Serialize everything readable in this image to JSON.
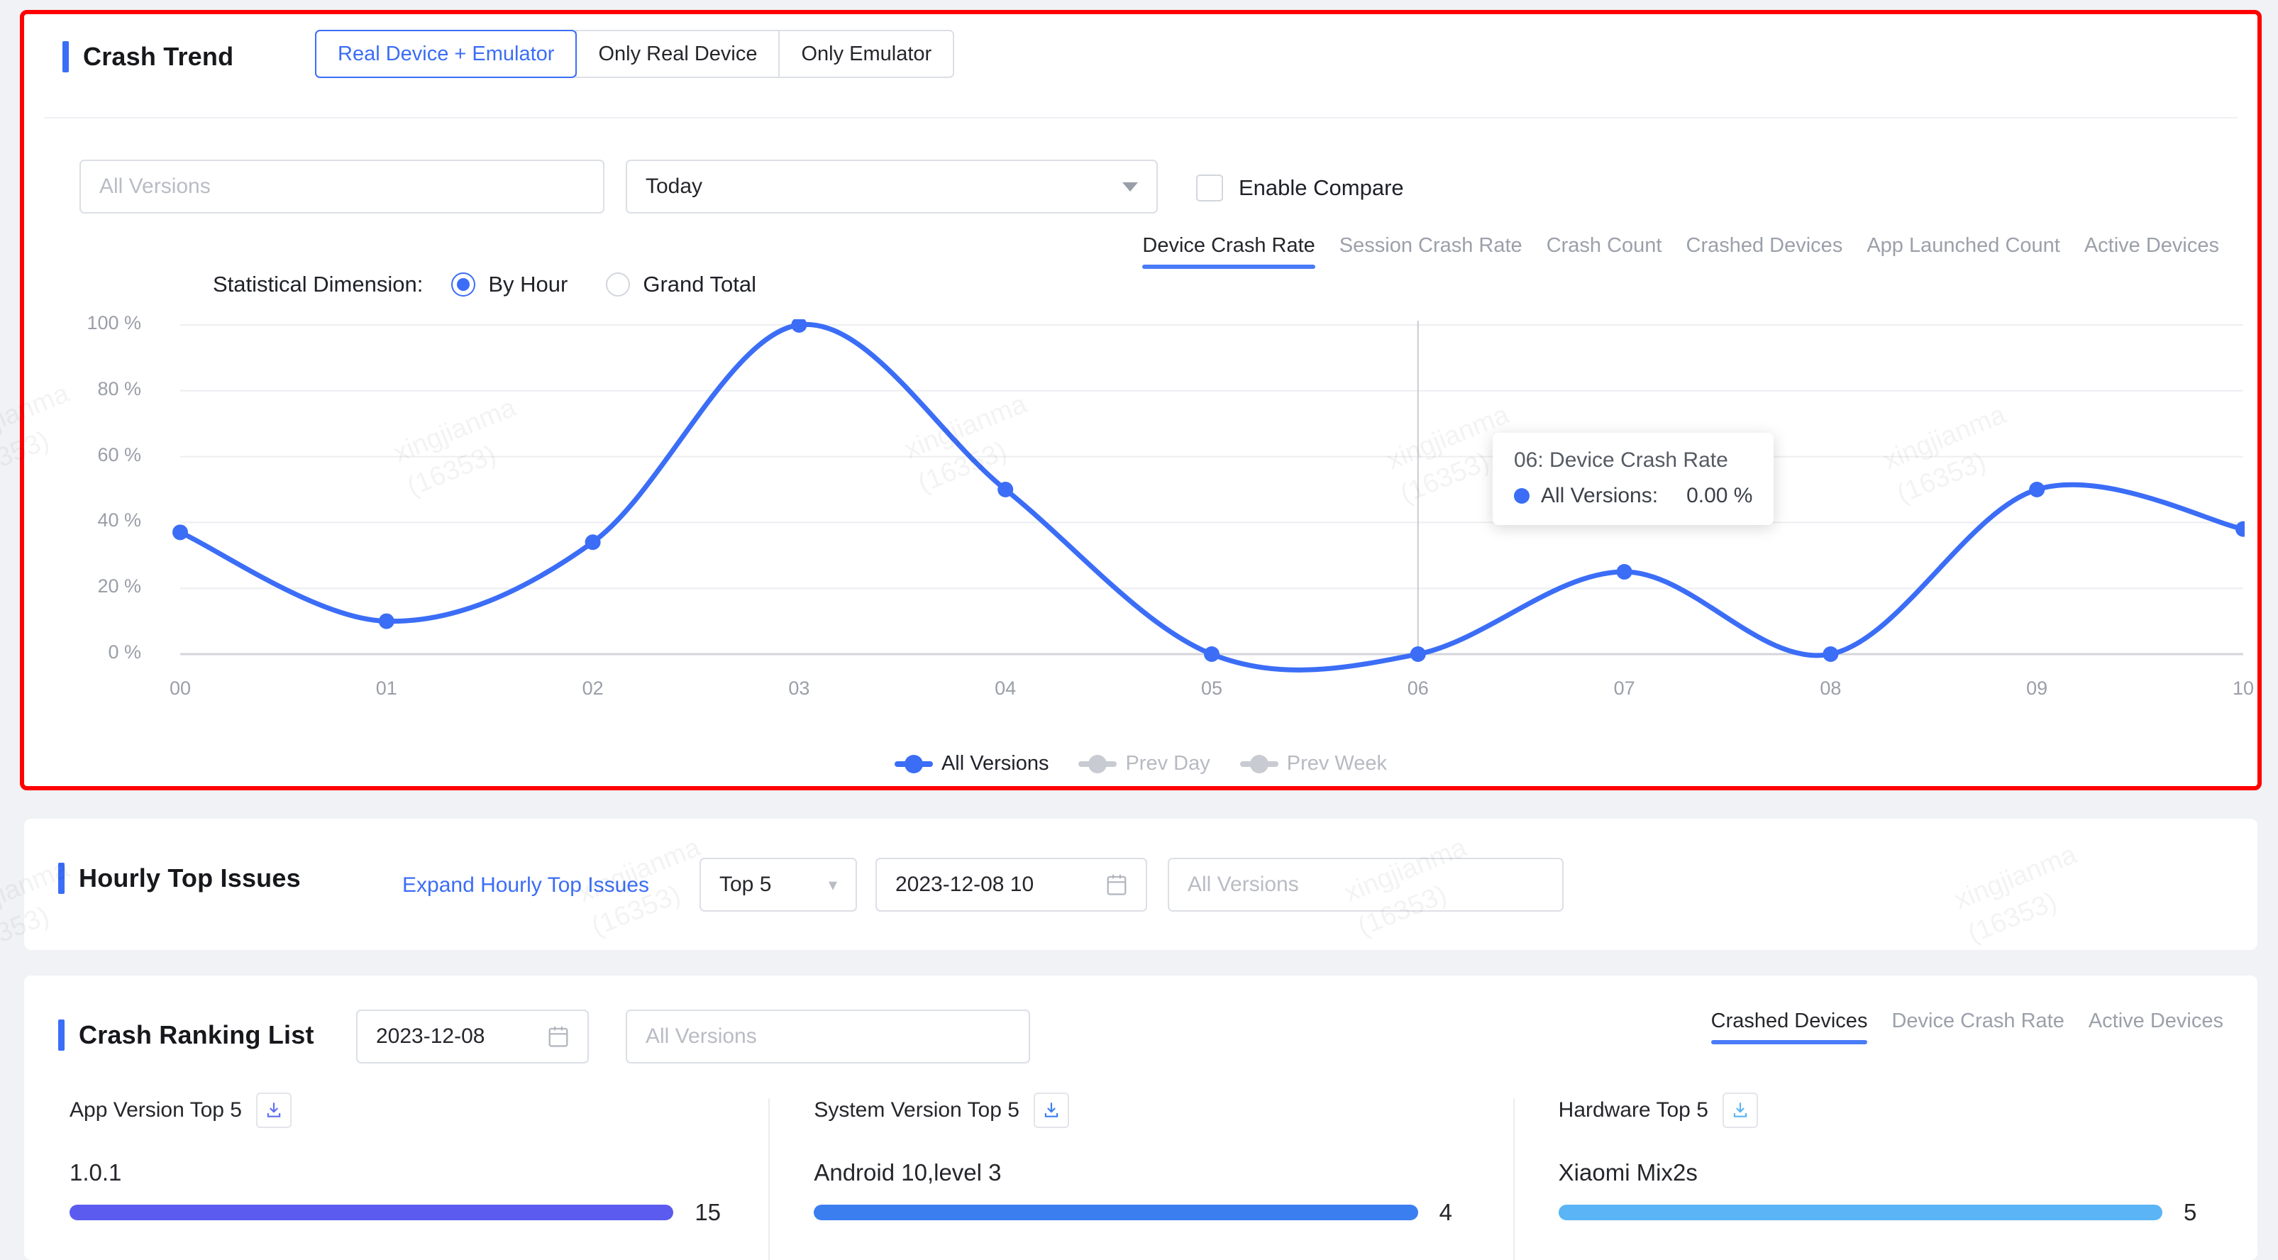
{
  "watermark": {
    "line1": "xingjianma",
    "line2": "(16353)"
  },
  "crash_trend": {
    "title": "Crash Trend",
    "device_filter": {
      "options": [
        "Real Device + Emulator",
        "Only Real Device",
        "Only Emulator"
      ],
      "selected": "Real Device + Emulator"
    },
    "version_input": {
      "placeholder": "All Versions",
      "value": ""
    },
    "date_select": {
      "value": "Today",
      "icon": "chevron-down-icon"
    },
    "enable_compare": {
      "label": "Enable Compare",
      "checked": false
    },
    "metric_tabs": {
      "items": [
        "Device Crash Rate",
        "Session Crash Rate",
        "Crash Count",
        "Crashed Devices",
        "App Launched Count",
        "Active Devices"
      ],
      "active": "Device Crash Rate"
    },
    "statistical_dimension": {
      "label": "Statistical Dimension:",
      "options": [
        "By Hour",
        "Grand Total"
      ],
      "selected": "By Hour"
    },
    "tooltip": {
      "title": "06: Device Crash Rate",
      "series_name": "All Versions:",
      "value": "0.00 %"
    },
    "legend": [
      {
        "label": "All Versions",
        "enabled": true,
        "color": "#3b6df6"
      },
      {
        "label": "Prev Day",
        "enabled": false,
        "color": "#c8cbd1"
      },
      {
        "label": "Prev Week",
        "enabled": false,
        "color": "#c8cbd1"
      }
    ]
  },
  "chart_data": {
    "type": "line",
    "title": "Crash Trend",
    "xlabel": "",
    "ylabel": "",
    "ylim": [
      0,
      100
    ],
    "yticks": [
      "0 %",
      "20 %",
      "40 %",
      "60 %",
      "80 %",
      "100 %"
    ],
    "ytick_values": [
      0,
      20,
      40,
      60,
      80,
      100
    ],
    "x": [
      "00",
      "01",
      "02",
      "03",
      "04",
      "05",
      "06",
      "07",
      "08",
      "09",
      "10"
    ],
    "grid": true,
    "legend_position": "bottom",
    "series": [
      {
        "name": "All Versions",
        "color": "#3b6df6",
        "values": [
          37,
          10,
          34,
          100,
          50,
          0,
          0,
          25,
          0,
          50,
          38
        ]
      },
      {
        "name": "Prev Day",
        "color": "#c8cbd1",
        "values": [],
        "hidden": true
      },
      {
        "name": "Prev Week",
        "color": "#c8cbd1",
        "values": [],
        "hidden": true
      }
    ],
    "marker_line": {
      "x": "06",
      "label": "06"
    }
  },
  "hourly_top_issues": {
    "title": "Hourly Top Issues",
    "expand_link": "Expand Hourly Top Issues",
    "top_select": {
      "value": "Top 5",
      "icon": "chevron-down-icon"
    },
    "datetime": {
      "value": "2023-12-08 10",
      "icon": "calendar-icon"
    },
    "version_input": {
      "placeholder": "All Versions",
      "value": ""
    }
  },
  "crash_ranking": {
    "title": "Crash Ranking List",
    "date": {
      "value": "2023-12-08",
      "icon": "calendar-icon"
    },
    "version_input": {
      "placeholder": "All Versions",
      "value": ""
    },
    "tabs": {
      "items": [
        "Crashed Devices",
        "Device Crash Rate",
        "Active Devices"
      ],
      "active": "Crashed Devices"
    },
    "columns": [
      {
        "title": "App Version Top 5",
        "download_icon": "download-icon",
        "color": "#5b5bf0",
        "rows": [
          {
            "label": "1.0.1",
            "value": "15",
            "pct": 100
          }
        ]
      },
      {
        "title": "System Version Top 5",
        "download_icon": "download-icon",
        "color": "#3b7ef0",
        "rows": [
          {
            "label": "Android 10,level 3",
            "value": "4",
            "pct": 100
          }
        ]
      },
      {
        "title": "Hardware Top 5",
        "download_icon": "download-icon",
        "color": "#5ab4f5",
        "rows": [
          {
            "label": "Xiaomi Mix2s",
            "value": "5",
            "pct": 100
          }
        ]
      }
    ]
  }
}
